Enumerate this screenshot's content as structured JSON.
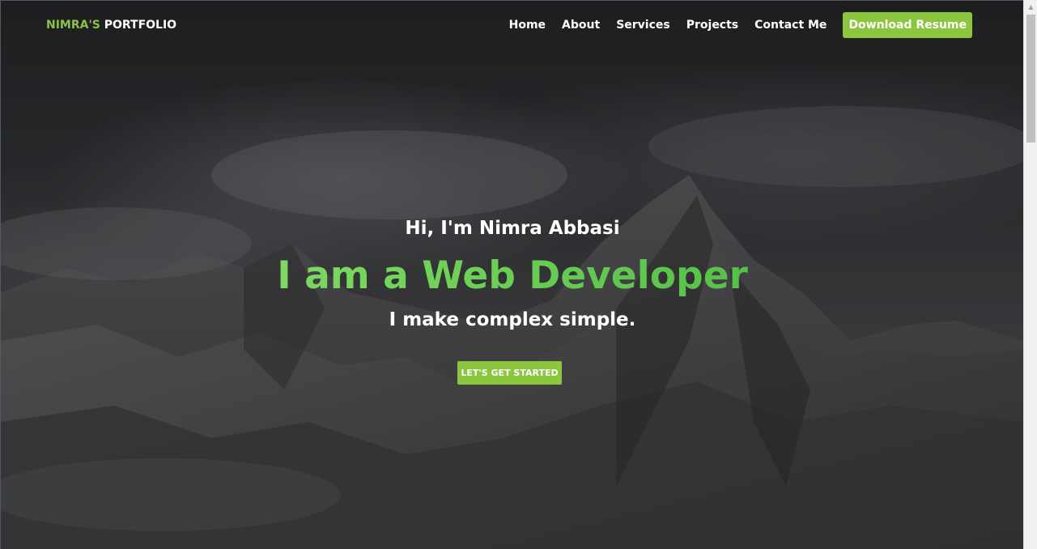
{
  "brand": {
    "accent": "NIMRA'S",
    "rest": "PORTFOLIO"
  },
  "nav": {
    "items": [
      {
        "label": "Home"
      },
      {
        "label": "About"
      },
      {
        "label": "Services"
      },
      {
        "label": "Projects"
      },
      {
        "label": "Contact Me"
      }
    ],
    "resume_button": "Download Resume"
  },
  "hero": {
    "greeting": "Hi, I'm Nimra Abbasi",
    "headline": "I am a Web Developer",
    "tagline": "I make complex simple.",
    "cta_label": "LET'S GET STARTED"
  },
  "colors": {
    "accent": "#8cc63f",
    "headline_gradient_start": "#9be17a",
    "headline_gradient_end": "#3fb03a",
    "background": "#2c2d30"
  },
  "icons": {
    "scroll_up": "chevron-up-icon"
  }
}
